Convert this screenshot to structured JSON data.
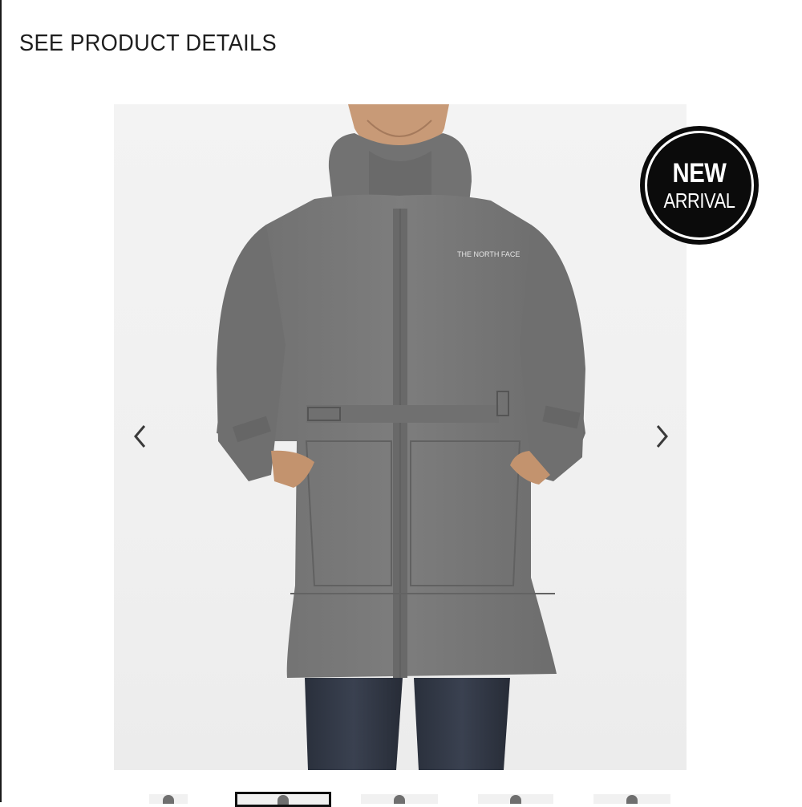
{
  "page": {
    "heading": "SEE PRODUCT DETAILS"
  },
  "product_image": {
    "brand_logo_text": "THE NORTH FACE",
    "jacket_color": "#777777",
    "pants_color": "#2d3340"
  },
  "badge": {
    "line1": "NEW",
    "line2": "ARRIVAL",
    "color": "#0b0b0b"
  },
  "carousel": {
    "prev_icon": "chevron-left-icon",
    "next_icon": "chevron-right-icon",
    "thumbnail_count": 5,
    "active_thumbnail": 2
  }
}
